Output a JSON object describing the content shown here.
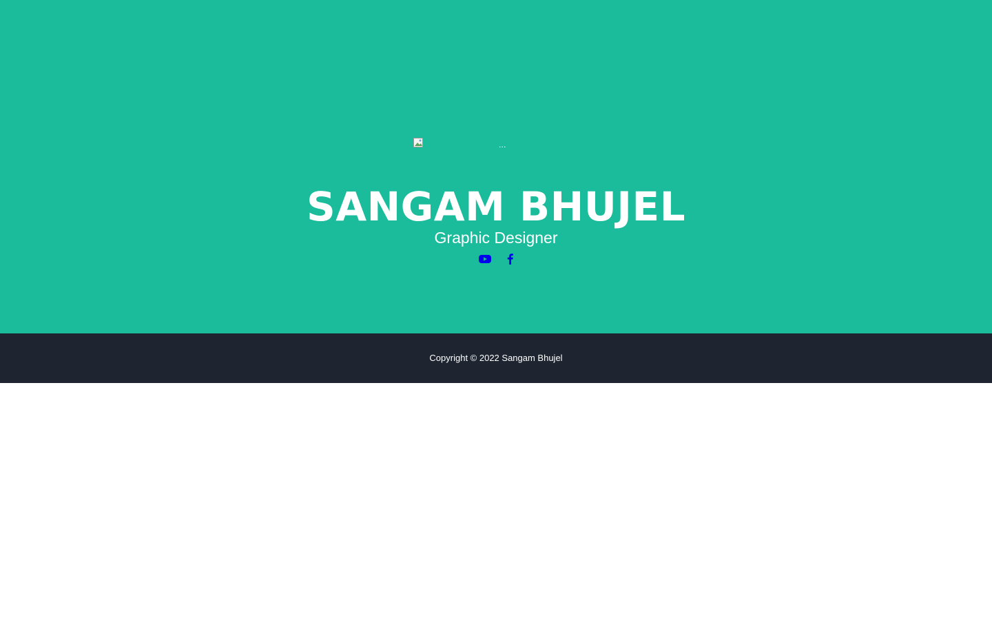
{
  "masthead": {
    "avatar_alt": "...",
    "name": "SANGAM BHUJEL",
    "subtitle": "Graphic Designer",
    "socials": [
      {
        "icon": "youtube-icon",
        "label": "YouTube"
      },
      {
        "icon": "facebook-icon",
        "label": "Facebook"
      }
    ]
  },
  "footer": {
    "copyright": "Copyright © 2022 Sangam Bhujel"
  },
  "colors": {
    "masthead_bg": "#1abc9c",
    "footer_bg": "#1e2530",
    "link": "#0000ee",
    "text": "#ffffff"
  }
}
